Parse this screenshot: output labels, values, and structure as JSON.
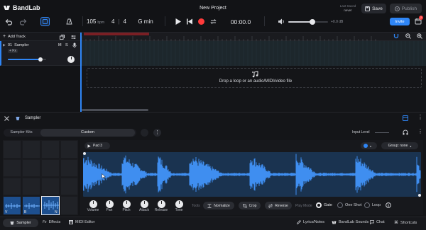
{
  "app": {
    "logo": "BandLab",
    "project_title": "New Project",
    "last_saved_label": "Last Saved",
    "last_saved_value": "never",
    "save": "Save",
    "publish": "Publish",
    "invite": "Invite",
    "notif_count": "2"
  },
  "transport": {
    "bpm": "105",
    "bpm_unit": "bpm",
    "time_sig_num": "4",
    "time_sig_den": "4",
    "key": "G min",
    "time": "00:00.0",
    "volume_db": "+0.0 dB",
    "volume_level": 0.6
  },
  "tracks_panel": {
    "add_track": "Add Track",
    "track": {
      "number": "01",
      "name": "Sampler",
      "fx": "+ Fx",
      "mute": "M",
      "solo": "S",
      "volume_level": 0.85
    }
  },
  "timeline": {
    "drop_text": "Drop a loop or an audio/MIDI/video file"
  },
  "sampler": {
    "title": "Sampler",
    "tab_kits": "Sampler Kits",
    "tab_custom": "Custom",
    "input_level": "Input Level",
    "pad_name": "Pad 3",
    "group": "Group: none",
    "pads_active": [
      {
        "key": "V"
      },
      {
        "key": "B"
      },
      {
        "key": "N"
      }
    ],
    "controls": [
      "Volume",
      "Pan",
      "Pitch",
      "Attack",
      "Release",
      "Tone"
    ],
    "tools_label": "Tools",
    "tools": [
      "Normalize",
      "Crop",
      "Reverse"
    ],
    "play_mode_label": "Play Mode",
    "play_modes": [
      "Gate",
      "One Shot",
      "Loop"
    ],
    "play_mode_selected": "Gate"
  },
  "footer": {
    "sampler": "Sampler",
    "effects": "Effects",
    "midi_editor": "MIDI Editor",
    "lyrics": "Lyrics/Notes",
    "sounds": "BandLab Sounds",
    "chat": "Chat",
    "shortcuts": "Shortcuts"
  },
  "colors": {
    "accent": "#2f86f6",
    "wave": "#3f8ef0",
    "record": "#ff3b3b",
    "bg": "#121316"
  }
}
